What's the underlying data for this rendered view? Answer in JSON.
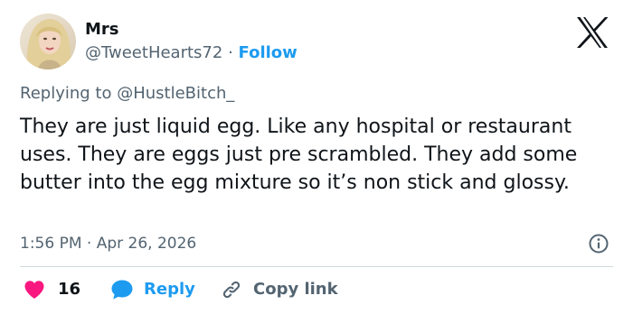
{
  "author": {
    "display_name": "Mrs",
    "handle": "@TweetHearts72",
    "separator": "·",
    "follow_label": "Follow"
  },
  "reply_context": {
    "prefix": "Replying to",
    "handle": "@HustleBitch_"
  },
  "tweet": {
    "text": "They are just liquid egg. Like any hospital or restaurant uses. They are eggs just pre scrambled. They add some butter into the egg mixture so it’s non stick and glossy.",
    "time": "1:56 PM",
    "separator": "·",
    "date": "Apr 26, 2026"
  },
  "actions": {
    "like_count": "16",
    "reply_label": "Reply",
    "copy_label": "Copy link"
  },
  "colors": {
    "accent": "#1d9bf0",
    "like": "#f91880",
    "muted": "#536471",
    "text": "#0f1419"
  },
  "icons": {
    "brand": "x-logo-icon",
    "info": "info-icon",
    "like": "heart-icon",
    "reply": "speech-bubble-icon",
    "copy": "link-icon"
  }
}
